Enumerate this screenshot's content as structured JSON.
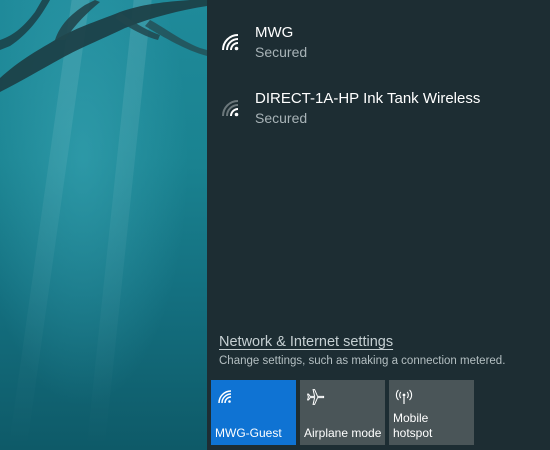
{
  "networks": [
    {
      "name": "MWG",
      "status": "Secured",
      "icon": "wifi-icon"
    },
    {
      "name": "DIRECT-1A-HP Ink Tank Wireless",
      "status": "Secured",
      "icon": "wifi-weak-icon"
    }
  ],
  "settings": {
    "link": "Network & Internet settings",
    "description": "Change settings, such as making a connection metered."
  },
  "quick_actions": [
    {
      "label": "MWG-Guest",
      "active": true,
      "icon": "wifi-icon"
    },
    {
      "label": "Airplane mode",
      "active": false,
      "icon": "airplane-icon"
    },
    {
      "label": "Mobile\nhotspot",
      "active": false,
      "icon": "hotspot-icon"
    }
  ],
  "colors": {
    "flyout_bg": "#1d2d33",
    "accent": "#0f73d3",
    "tile_bg": "#4a5558"
  }
}
